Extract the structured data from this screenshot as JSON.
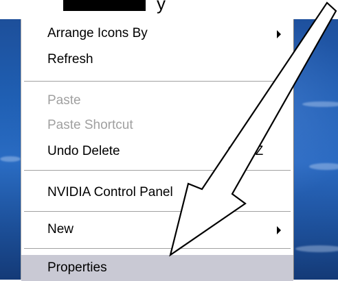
{
  "top_text": "y",
  "menu": {
    "items": [
      {
        "label": "Arrange Icons By",
        "has_submenu": true
      },
      {
        "label": "Refresh"
      },
      {
        "label": "Paste",
        "disabled": true
      },
      {
        "label": "Paste Shortcut",
        "disabled": true
      },
      {
        "label": "Undo Delete",
        "shortcut": "Ctrl+Z"
      },
      {
        "label": "NVIDIA Control Panel"
      },
      {
        "label": "New",
        "has_submenu": true
      },
      {
        "label": "Properties",
        "selected": true
      }
    ]
  },
  "colors": {
    "desktop_blue": "#1f5fb3",
    "selected_highlight": "#c9c9d4",
    "disabled_text": "#a0a0a0"
  },
  "icons": {
    "submenu": "chevron-right-icon",
    "annotation": "arrow-pointer-icon"
  }
}
